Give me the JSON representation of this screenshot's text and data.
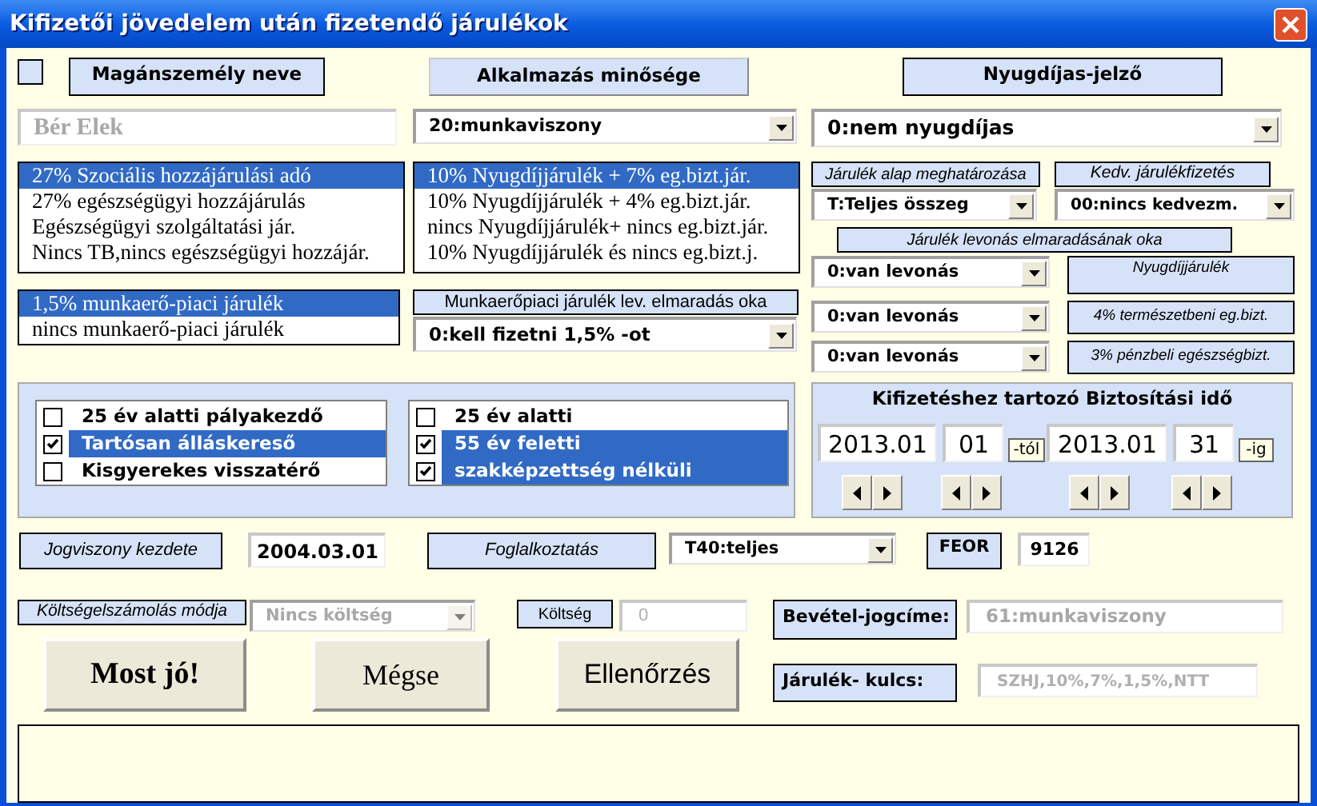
{
  "window": {
    "title": "Kifizetői jövedelem után fizetendő járulékok"
  },
  "private_checkbox": {
    "checked": false
  },
  "headers": [
    "Magánszemély neve",
    "Alkalmazás minősége",
    "Nyugdíjas-jelző"
  ],
  "name_field": {
    "value": "Bér Elek"
  },
  "employment_combo": {
    "value": "20:munkaviszony"
  },
  "pension_combo": {
    "value": "0:nem nyugdíjas"
  },
  "social_list": [
    {
      "label": "27% Szociális hozzájárulási adó",
      "selected": true
    },
    {
      "label": "27% egészségügyi hozzájárulás",
      "selected": false
    },
    {
      "label": "Egészségügyi szolgáltatási jár.",
      "selected": false
    },
    {
      "label": "Nincs TB,nincs egészségügyi hozzájár.",
      "selected": false
    }
  ],
  "pension_list": [
    {
      "label": "10% Nyugdíjjárulék + 7% eg.bizt.jár.",
      "selected": true
    },
    {
      "label": "10% Nyugdíjjárulék + 4% eg.bizt.jár.",
      "selected": false
    },
    {
      "label": "nincs Nyugdíjjárulék+ nincs eg.bizt.jár.",
      "selected": false
    },
    {
      "label": "10% Nyugdíjjárulék és nincs eg.bizt.j.",
      "selected": false
    }
  ],
  "labor_list": [
    {
      "label": "1,5% munkaerő-piaci járulék",
      "selected": true
    },
    {
      "label": "nincs munkaerő-piaci járulék",
      "selected": false
    }
  ],
  "labor_reason": {
    "label": "Munkaerőpiaci járulék lev. elmaradás oka",
    "value": "0:kell fizetni 1,5% -ot"
  },
  "base": {
    "label": "Járulék alap meghatározása",
    "value": "T:Teljes összeg"
  },
  "discount": {
    "label": "Kedv. járulékfizetés",
    "value": "00:nincs kedvezm."
  },
  "deduction_reason": {
    "label": "Járulék levonás elmaradásának oka",
    "rows": [
      {
        "value": "0:van levonás",
        "note": "Nyugdíjjárulék"
      },
      {
        "value": "0:van levonás",
        "note": "4% természetbeni eg.bizt."
      },
      {
        "value": "0:van levonás",
        "note": "3% pénzbeli egészségbizt."
      }
    ]
  },
  "checklist_left": [
    {
      "label": "25 év alatti pályakezdő",
      "checked": false,
      "selected": false
    },
    {
      "label": "Tartósan álláskereső",
      "checked": true,
      "selected": true
    },
    {
      "label": "Kisgyerekes visszatérő",
      "checked": false,
      "selected": false
    }
  ],
  "checklist_right": [
    {
      "label": "25 év alatti",
      "checked": false,
      "selected": false
    },
    {
      "label": "55 év feletti",
      "checked": true,
      "selected": true
    },
    {
      "label": "szakképzettség nélküli",
      "checked": true,
      "selected": true
    }
  ],
  "period": {
    "title": "Kifizetéshez tartozó Biztosítási  idő",
    "from_month": "2013.01",
    "from_day": "01",
    "from_suffix": "-tól",
    "to_month": "2013.01",
    "to_day": "31",
    "to_suffix": "-ig"
  },
  "start": {
    "label": "Jogviszony kezdete",
    "value": "2004.03.01"
  },
  "work_time": {
    "label": "Foglalkoztatás",
    "value": "T40:teljes"
  },
  "feor": {
    "label": "FEOR",
    "value": "9126"
  },
  "cost_method": {
    "label": "Költségelszámolás módja",
    "value": "Nincs költség",
    "disabled": true
  },
  "cost": {
    "label": "Költség",
    "value": "0",
    "disabled": true
  },
  "income_title": {
    "label": "Bevétel-jogcíme:",
    "value": "61:munkaviszony"
  },
  "rate_key": {
    "label": "Járulék- kulcs:",
    "value": "SZHJ,10%,7%,1,5%,NTT"
  },
  "buttons": [
    {
      "label": "Most jó!",
      "kind": "bold-serif"
    },
    {
      "label": "Mégse",
      "kind": "serif"
    },
    {
      "label": "Ellenőrzés",
      "kind": "sans"
    }
  ]
}
